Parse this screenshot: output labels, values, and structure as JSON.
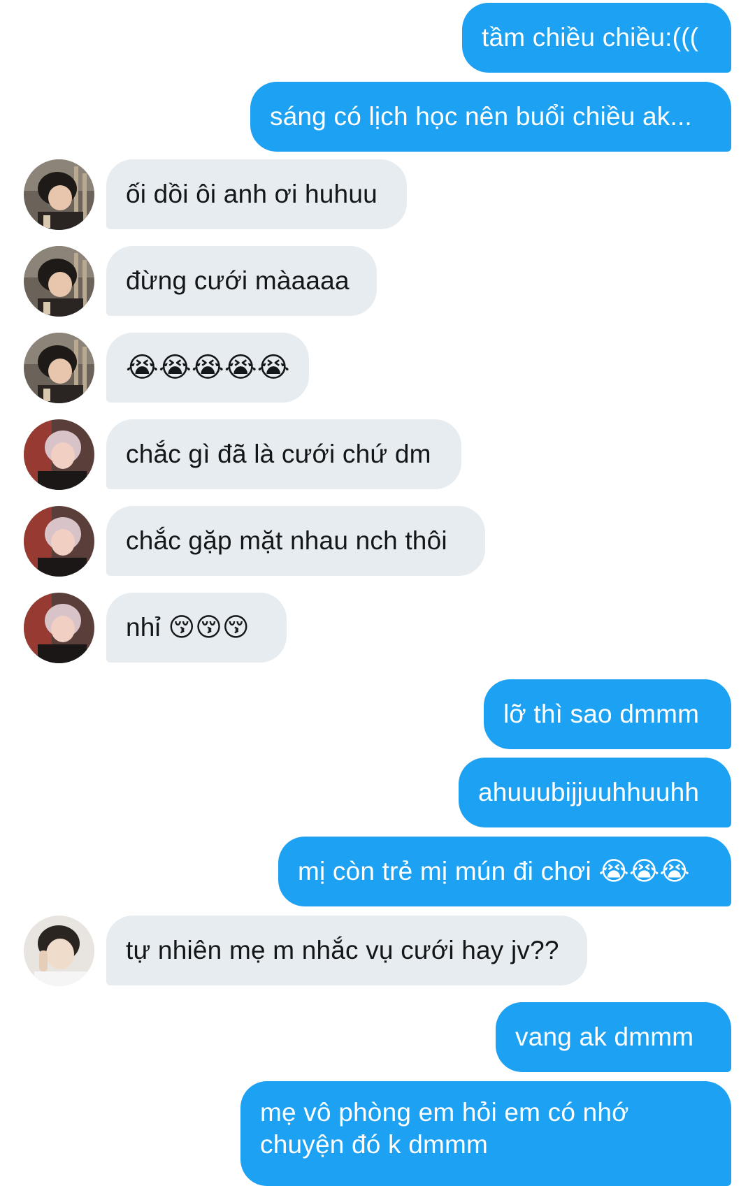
{
  "messages": [
    {
      "side": "out",
      "text": "tầm chiều chiều:((("
    },
    {
      "side": "out",
      "text": "sáng có lịch học nên buổi chiều ak..."
    },
    {
      "side": "in",
      "sender": "avatar-a",
      "text": "ối dồi ôi anh ơi huhuu"
    },
    {
      "side": "in",
      "sender": "avatar-a",
      "text": "đừng cưới màaaaa"
    },
    {
      "side": "in",
      "sender": "avatar-a",
      "text": "😭😭😭😭😭"
    },
    {
      "side": "in",
      "sender": "avatar-b",
      "text": "chắc gì đã là cưới chứ dm"
    },
    {
      "side": "in",
      "sender": "avatar-b",
      "text": "chắc gặp mặt nhau nch thôi"
    },
    {
      "side": "in",
      "sender": "avatar-b",
      "text": "nhỉ 😚😚😚"
    },
    {
      "side": "out",
      "text": "lỡ thì sao dmmm"
    },
    {
      "side": "out",
      "text": "ahuuubijjuuhhuuhh"
    },
    {
      "side": "out",
      "text": "mị còn trẻ mị mún đi chơi 😭😭😭"
    },
    {
      "side": "in",
      "sender": "avatar-c",
      "text": "tự nhiên mẹ m nhắc vụ cưới hay jv??"
    },
    {
      "side": "out",
      "text": "vang ak dmmm"
    },
    {
      "side": "out",
      "text": "mẹ vô phòng em hỏi em có nhớ chuyện đó k dmmm"
    }
  ],
  "colors": {
    "outgoing_bubble": "#1da1f2",
    "incoming_bubble": "#e6ecf0",
    "outgoing_text": "#ffffff",
    "incoming_text": "#14171a"
  }
}
